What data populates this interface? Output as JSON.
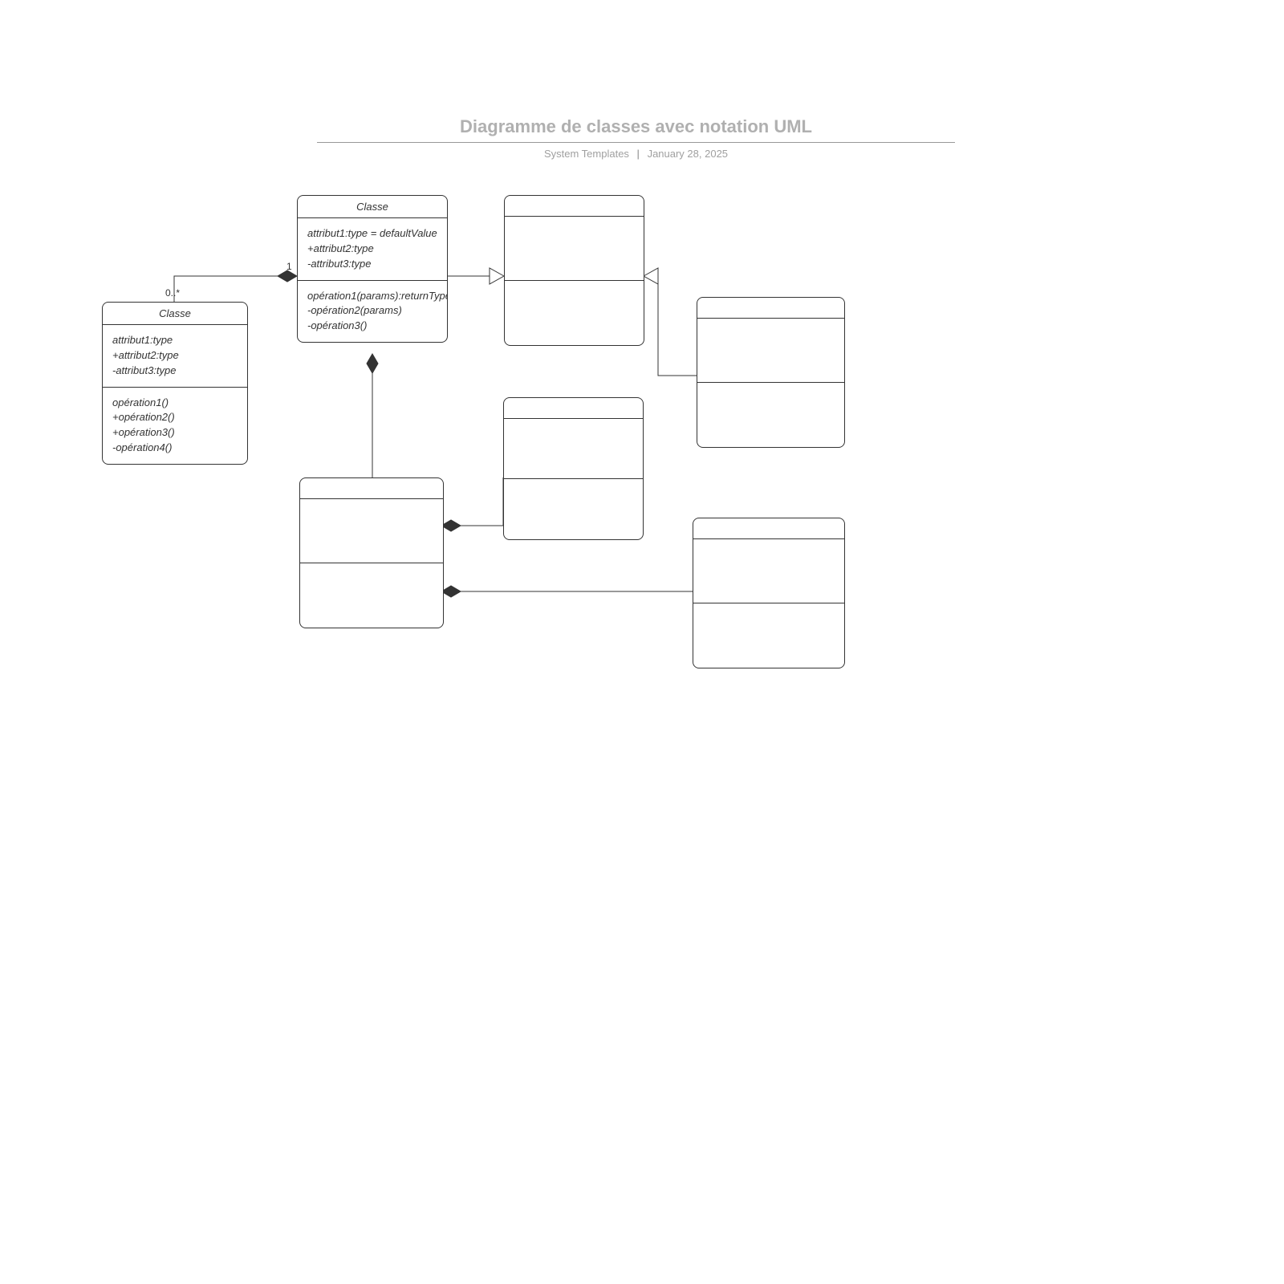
{
  "header": {
    "title": "Diagramme de classes avec notation UML",
    "author": "System Templates",
    "date": "January 28, 2025"
  },
  "labels": {
    "mult_one": "1",
    "mult_many": "0..*"
  },
  "classes": {
    "c1": {
      "name": "Classe",
      "attrs": [
        "attribut1:type",
        "+attribut2:type",
        "-attribut3:type"
      ],
      "ops": [
        "opération1()",
        "+opération2()",
        "+opération3()",
        "-opération4()"
      ]
    },
    "c2": {
      "name": "Classe",
      "attrs": [
        "attribut1:type = defaultValue",
        "+attribut2:type",
        "-attribut3:type"
      ],
      "ops": [
        "opération1(params):returnType",
        "-opération2(params)",
        "-opération3()"
      ]
    },
    "c3": {
      "name": "",
      "attrs": [],
      "ops": []
    },
    "c4": {
      "name": "",
      "attrs": [],
      "ops": []
    },
    "c5": {
      "name": "",
      "attrs": [],
      "ops": []
    },
    "c6": {
      "name": "",
      "attrs": [],
      "ops": []
    },
    "c7": {
      "name": "",
      "attrs": [],
      "ops": []
    }
  }
}
